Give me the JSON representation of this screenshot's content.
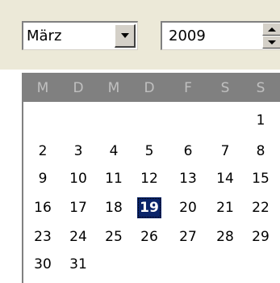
{
  "month_select": {
    "value": "März",
    "dropdown_icon": "chevron-down-icon"
  },
  "year_spinner": {
    "value": "2009",
    "up_icon": "arrow-up-icon",
    "down_icon": "arrow-down-icon"
  },
  "calendar": {
    "weekdays": [
      "M",
      "D",
      "M",
      "D",
      "F",
      "S",
      "S"
    ],
    "weeks": [
      [
        "",
        "",
        "",
        "",
        "",
        "",
        "1"
      ],
      [
        "2",
        "3",
        "4",
        "5",
        "6",
        "7",
        "8"
      ],
      [
        "9",
        "10",
        "11",
        "12",
        "13",
        "14",
        "15"
      ],
      [
        "16",
        "17",
        "18",
        "19",
        "20",
        "21",
        "22"
      ],
      [
        "23",
        "24",
        "25",
        "26",
        "27",
        "28",
        "29"
      ],
      [
        "30",
        "31",
        "",
        "",
        "",
        "",
        ""
      ]
    ],
    "selected_day": "19",
    "colors": {
      "header_bg": "#808080",
      "header_text": "#c0c0c0",
      "selected_bg": "#0a246a",
      "selected_text": "#ffffff"
    }
  }
}
